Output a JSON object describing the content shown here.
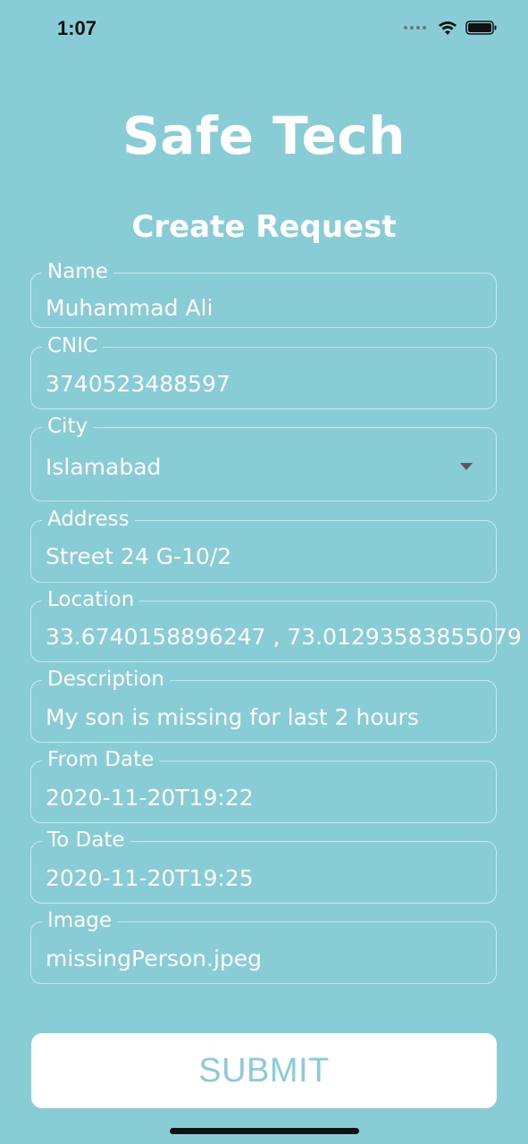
{
  "status_bar": {
    "time": "1:07"
  },
  "header": {
    "app_title": "Safe Tech",
    "page_title": "Create Request"
  },
  "form": {
    "fields": [
      {
        "label": "Name",
        "value": "Muhammad Ali"
      },
      {
        "label": "CNIC",
        "value": "3740523488597"
      },
      {
        "label": "City",
        "value": "Islamabad"
      },
      {
        "label": "Address",
        "value": "Street 24 G-10/2"
      },
      {
        "label": "Location",
        "value": "33.6740158896247 , 73.01293583855079"
      },
      {
        "label": "Description",
        "value": "My son is missing for last 2 hours"
      },
      {
        "label": "From Date",
        "value": "2020-11-20T19:22"
      },
      {
        "label": "To Date",
        "value": "2020-11-20T19:25"
      },
      {
        "label": "Image",
        "value": "missingPerson.jpeg"
      }
    ],
    "submit_label": "SUBMIT"
  },
  "colors": {
    "background": "#88CCD6",
    "text": "#ffffff",
    "button_bg": "#ffffff",
    "button_text": "#88CCD6"
  },
  "icons": {
    "status": [
      "cellular-signal-icon",
      "wifi-icon",
      "battery-icon"
    ],
    "city_dropdown": "dropdown-arrow-icon"
  }
}
